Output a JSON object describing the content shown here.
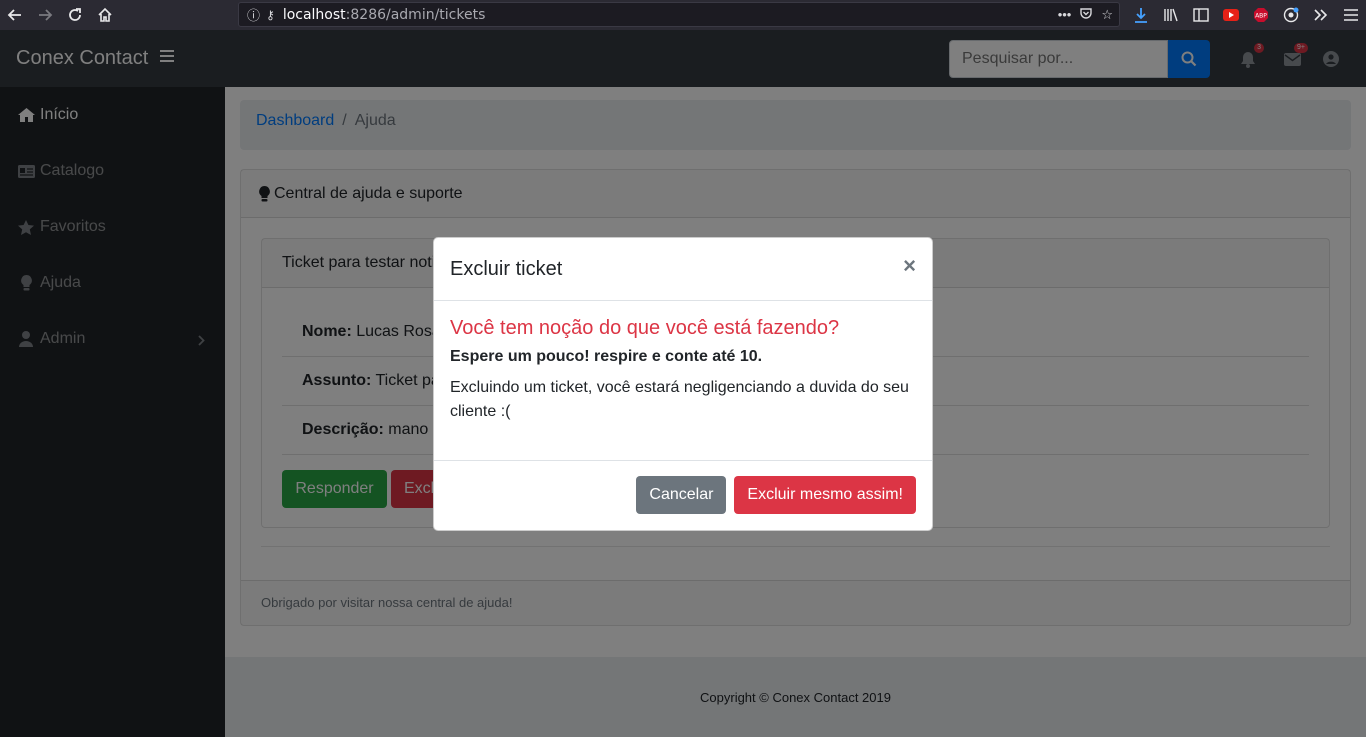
{
  "browser": {
    "url_host": "localhost",
    "url_rest": ":8286/admin/tickets"
  },
  "navbar": {
    "brand": "Conex Contact",
    "search_placeholder": "Pesquisar por...",
    "bell_badge": "3",
    "mail_badge": "9+"
  },
  "sidebar": {
    "items": [
      {
        "label": "Início",
        "icon": "home-icon"
      },
      {
        "label": "Catalogo",
        "icon": "id-card-icon"
      },
      {
        "label": "Favoritos",
        "icon": "star-icon"
      },
      {
        "label": "Ajuda",
        "icon": "lightbulb-icon"
      },
      {
        "label": "Admin",
        "icon": "user-icon"
      }
    ]
  },
  "breadcrumb": {
    "link": "Dashboard",
    "separator": "/",
    "current": "Ajuda"
  },
  "card": {
    "title": "Central de ajuda e suporte",
    "ticket_title": "Ticket para testar noti",
    "rows": [
      {
        "label": "Nome:",
        "value": "Lucas Rosa"
      },
      {
        "label": "Assunto:",
        "value": "Ticket pa"
      },
      {
        "label": "Descrição:",
        "value": "mano"
      }
    ],
    "reply_button": "Responder",
    "delete_button": "Excluir",
    "footer": "Obrigado por visitar nossa central de ajuda!"
  },
  "page_footer": "Copyright © Conex Contact 2019",
  "modal": {
    "title": "Excluir ticket",
    "close": "×",
    "heading": "Você tem noção do que você está fazendo?",
    "subheading": "Espere um pouco! respire e conte até 10.",
    "body": "Excluindo um ticket, você estará negligenciando a duvida do seu cliente :(",
    "cancel_button": "Cancelar",
    "confirm_button": "Excluir mesmo assim!"
  },
  "colors": {
    "primary": "#007bff",
    "danger": "#dc3545",
    "success": "#28a745",
    "secondary": "#6c757d",
    "dark": "#343a40"
  }
}
